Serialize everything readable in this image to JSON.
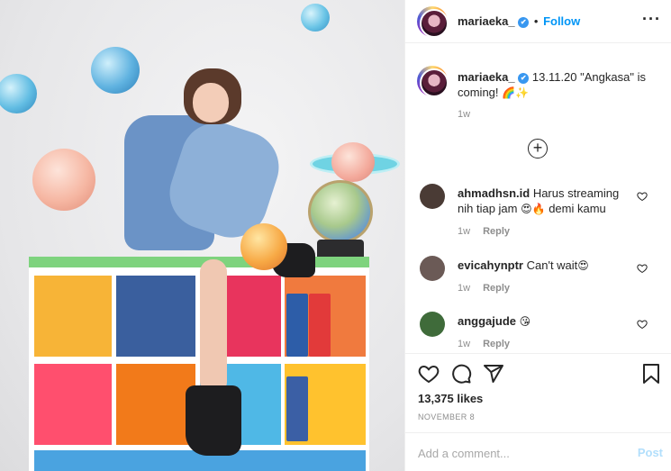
{
  "post": {
    "username": "mariaeka_",
    "verified_mark": "✔",
    "separator": "•",
    "follow_label": "Follow",
    "more_icon": "more-horizontal-icon",
    "caption_date": "13.11.20",
    "caption_text": "\"Angkasa\" is coming!",
    "caption_emojis": "🌈✨",
    "caption_age": "1w",
    "load_more_icon": "plus-circle-icon"
  },
  "comments": [
    {
      "username": "ahmadhsn.id",
      "text": "Harus streaming nih tiap jam",
      "emojis_mid": "😍🔥",
      "text_after": "demi kamu",
      "age": "1w",
      "reply_label": "Reply",
      "avatar_color": "#4a3b35"
    },
    {
      "username": "evicahynptr",
      "text": "Can't wait",
      "emojis_mid": "😍",
      "text_after": "",
      "age": "1w",
      "reply_label": "Reply",
      "avatar_color": "#6b5a56"
    },
    {
      "username": "anggajude",
      "text": "",
      "emojis_mid": "😘",
      "text_after": "",
      "age": "1w",
      "reply_label": "Reply",
      "avatar_color": "#3f6b3a"
    }
  ],
  "actions": {
    "like_icon": "heart-icon",
    "comment_icon": "comment-icon",
    "share_icon": "send-icon",
    "save_icon": "bookmark-icon",
    "likes_text": "13,375 likes",
    "date_text": "NOVEMBER 8",
    "comment_placeholder": "Add a comment...",
    "post_label": "Post"
  },
  "colors": {
    "link_blue": "#0095f6",
    "verified_blue": "#3897f0",
    "muted_text": "#8e8e8e",
    "post_disabled": "#b2dffc"
  }
}
